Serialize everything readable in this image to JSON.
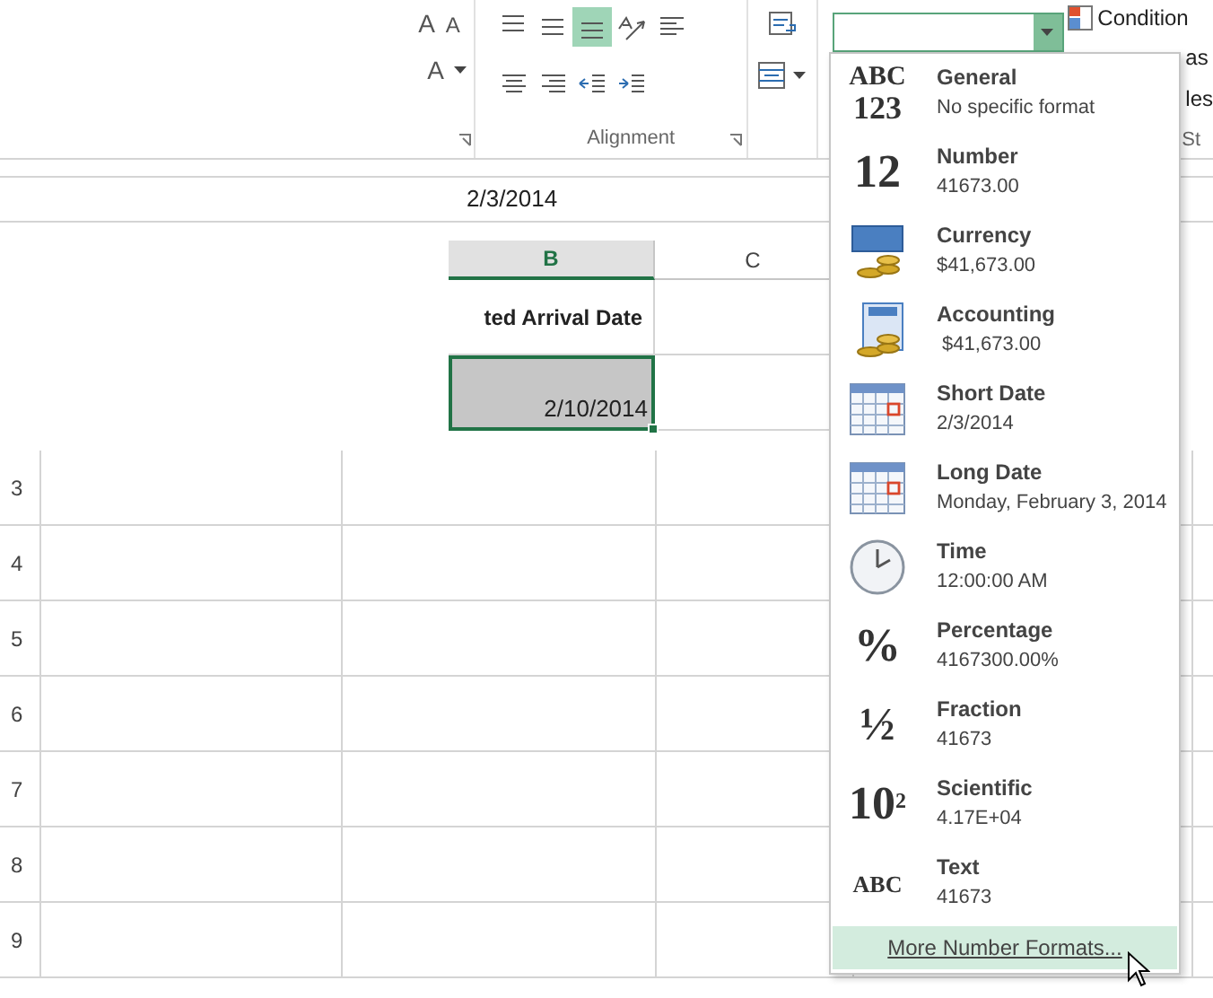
{
  "ribbon": {
    "font_buttons": [
      {
        "kind": "grow",
        "glyph": "A"
      },
      {
        "kind": "shrink",
        "glyph": "A"
      },
      {
        "kind": "color",
        "glyph": "A"
      }
    ],
    "alignment_buttons": [
      {
        "kind": "top",
        "selected": false
      },
      {
        "kind": "middle",
        "selected": false
      },
      {
        "kind": "bottom",
        "selected": true
      },
      {
        "kind": "orient",
        "selected": false
      },
      {
        "kind": "left",
        "selected": false
      },
      {
        "kind": "center",
        "selected": false
      },
      {
        "kind": "right",
        "selected": false
      },
      {
        "kind": "outdent",
        "selected": false
      },
      {
        "kind": "indent",
        "selected": false
      }
    ],
    "alignment_label": "Alignment",
    "styles": {
      "conditional": "Condition",
      "format_table": "as",
      "cell_styles": "les",
      "group_label": "St"
    }
  },
  "formula_bar": {
    "value": "2/3/2014"
  },
  "columns": [
    {
      "label": "B",
      "selected": true
    },
    {
      "label": "C",
      "selected": false
    }
  ],
  "cells": {
    "header": "ted Arrival Date",
    "date": "2/10/2014"
  },
  "rows": [
    "3",
    "4",
    "5",
    "6",
    "7",
    "8",
    "9"
  ],
  "format_menu": {
    "items": [
      {
        "kind": "glyph",
        "glyph": "ABC",
        "glyph2": "123",
        "name": "General",
        "example": "No specific format"
      },
      {
        "kind": "glyph",
        "glyph": "12",
        "name": "Number",
        "example": "41673.00"
      },
      {
        "kind": "currency",
        "name": "Currency",
        "example": "$41,673.00"
      },
      {
        "kind": "accounting",
        "name": "Accounting",
        "example": " $41,673.00"
      },
      {
        "kind": "calendar",
        "name": "Short Date",
        "example": "2/3/2014"
      },
      {
        "kind": "calendar",
        "name": "Long Date",
        "example": "Monday, February 3, 2014"
      },
      {
        "kind": "clock",
        "name": "Time",
        "example": "12:00:00 AM"
      },
      {
        "kind": "glyph",
        "glyph": "%",
        "name": "Percentage",
        "example": "4167300.00%"
      },
      {
        "kind": "glyph",
        "glyph": "½",
        "name": "Fraction",
        "example": "41673"
      },
      {
        "kind": "glyph",
        "glyph": "10",
        "sup": "2",
        "name": "Scientific",
        "example": "4.17E+04"
      },
      {
        "kind": "glyph",
        "glyph": "ABC",
        "small": true,
        "name": "Text",
        "example": "41673"
      }
    ],
    "more_button": "More Number Formats..."
  }
}
